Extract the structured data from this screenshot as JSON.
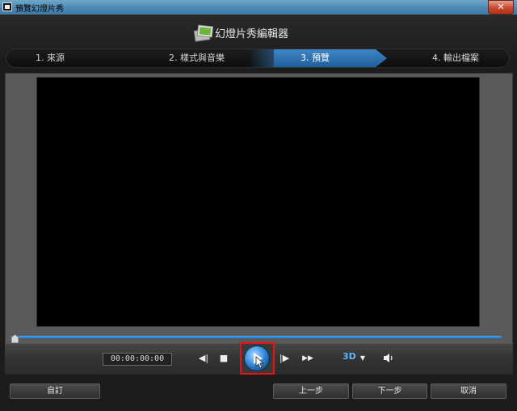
{
  "window": {
    "title": "預覽幻燈片秀",
    "close_glyph": "✕"
  },
  "app": {
    "title": "幻燈片秀編輯器"
  },
  "steps": [
    {
      "label": "1. 來源",
      "active": false
    },
    {
      "label": "2. 樣式與音樂",
      "active": false
    },
    {
      "label": "3. 預覽",
      "active": true
    },
    {
      "label": "4. 輸出檔案",
      "active": false
    }
  ],
  "player": {
    "timecode": "00:00:00:00",
    "progress": 0,
    "prev_frame_glyph": "◀|",
    "stop_glyph": "■",
    "next_frame_glyph": "|▶",
    "fast_forward_glyph": "▶▶",
    "mode_3d_label": "3D",
    "mode_3d_arrow": "▼"
  },
  "buttons": {
    "customize": "自訂",
    "back": "上一步",
    "next": "下一步",
    "cancel": "取消"
  },
  "colors": {
    "accent": "#2f7fd0",
    "highlight_box": "#e11111"
  },
  "icons": [
    "app-window-icon",
    "close-icon",
    "slideshow-logo-icon",
    "seek-handle-icon",
    "prev-frame-icon",
    "stop-icon",
    "play-icon",
    "next-frame-icon",
    "fast-forward-icon",
    "3d-mode-icon",
    "volume-icon"
  ]
}
